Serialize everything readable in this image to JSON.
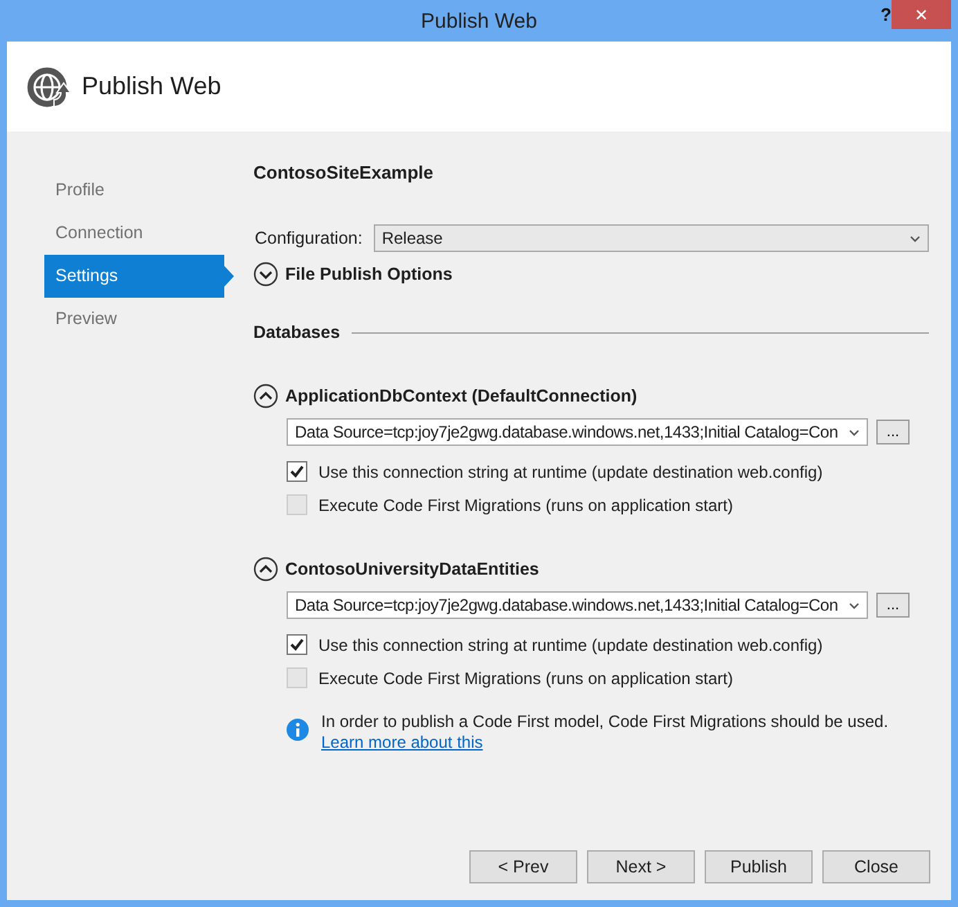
{
  "window": {
    "title": "Publish Web",
    "help": "?",
    "close": "✕"
  },
  "header": {
    "title": "Publish Web"
  },
  "sidebar": {
    "items": [
      {
        "label": "Profile",
        "selected": false
      },
      {
        "label": "Connection",
        "selected": false
      },
      {
        "label": "Settings",
        "selected": true
      },
      {
        "label": "Preview",
        "selected": false
      }
    ]
  },
  "profile_name": "ContosoSiteExample",
  "configuration": {
    "label": "Configuration:",
    "value": "Release"
  },
  "file_publish_options": {
    "label": "File Publish Options",
    "expanded": false
  },
  "databases": {
    "label": "Databases",
    "items": [
      {
        "name": "ApplicationDbContext (DefaultConnection)",
        "expanded": true,
        "connection_string": "Data Source=tcp:joy7je2gwg.database.windows.net,1433;Initial Catalog=Con",
        "browse": "...",
        "options": [
          {
            "label": "Use this connection string at runtime (update destination web.config)",
            "checked": true,
            "disabled": false
          },
          {
            "label": "Execute Code First Migrations (runs on application start)",
            "checked": false,
            "disabled": true
          }
        ]
      },
      {
        "name": "ContosoUniversityDataEntities",
        "expanded": true,
        "connection_string": "Data Source=tcp:joy7je2gwg.database.windows.net,1433;Initial Catalog=Con",
        "browse": "...",
        "options": [
          {
            "label": "Use this connection string at runtime (update destination web.config)",
            "checked": true,
            "disabled": false
          },
          {
            "label": "Execute Code First Migrations (runs on application start)",
            "checked": false,
            "disabled": true
          }
        ]
      }
    ]
  },
  "info": {
    "message": "In order to publish a Code First model, Code First Migrations should be used.",
    "link": "Learn more about this"
  },
  "buttons": [
    "< Prev",
    "Next >",
    "Publish",
    "Close"
  ]
}
